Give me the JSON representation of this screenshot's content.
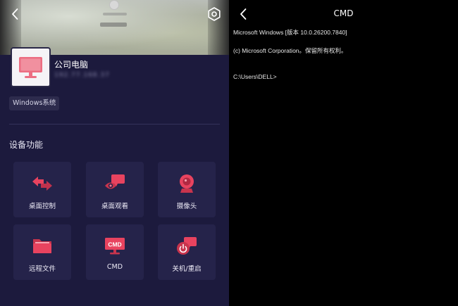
{
  "device": {
    "name": "公司电脑",
    "ip": "192.77.168.37",
    "os_badge": "Windows系统"
  },
  "section": {
    "title": "设备功能"
  },
  "features": [
    {
      "label": "桌面控制",
      "icon": "desktop-control-icon"
    },
    {
      "label": "桌面观看",
      "icon": "desktop-view-icon"
    },
    {
      "label": "摄像头",
      "icon": "camera-icon"
    },
    {
      "label": "远程文件",
      "icon": "folder-icon"
    },
    {
      "label": "CMD",
      "icon": "cmd-icon",
      "icon_text": "CMD"
    },
    {
      "label": "关机/重启",
      "icon": "power-icon"
    }
  ],
  "cmd": {
    "title": "CMD",
    "lines": [
      "Microsoft Windows [版本 10.0.26200.7840]",
      "(c) Microsoft Corporation。保留所有权利。",
      "C:\\Users\\DELL>"
    ]
  },
  "colors": {
    "accent": "#e8435f",
    "panel_bg": "#1c1a3d",
    "card_bg": "#25234a",
    "terminal_bg": "#000000"
  }
}
